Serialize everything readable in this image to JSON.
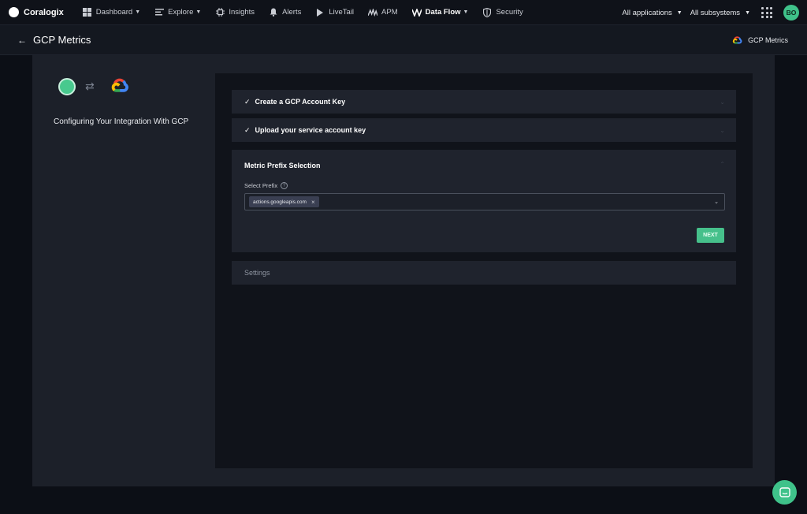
{
  "app": {
    "brand": "Coralogix",
    "avatar_initials": "BO",
    "accent_color": "#46c08b"
  },
  "nav": {
    "items": [
      {
        "label": "Dashboard",
        "icon": "dashboard-icon",
        "has_caret": true
      },
      {
        "label": "Explore",
        "icon": "explore-icon",
        "has_caret": true
      },
      {
        "label": "Insights",
        "icon": "insights-icon",
        "has_caret": false
      },
      {
        "label": "Alerts",
        "icon": "bell-icon",
        "has_caret": false
      },
      {
        "label": "LiveTail",
        "icon": "play-icon",
        "has_caret": false
      },
      {
        "label": "APM",
        "icon": "apm-icon",
        "has_caret": false
      },
      {
        "label": "Data Flow",
        "icon": "data-flow-icon",
        "has_caret": true
      },
      {
        "label": "Security",
        "icon": "shield-icon",
        "has_caret": false
      }
    ],
    "applications": "All applications",
    "subsystems": "All subsystems"
  },
  "header": {
    "title": "GCP Metrics",
    "right_label": "GCP Metrics"
  },
  "left": {
    "config_label": "Configuring Your Integration With GCP"
  },
  "steps": {
    "step1": "Create a GCP Account Key",
    "step2": "Upload your service account key",
    "step3": "Metric Prefix Selection",
    "step4": "Settings"
  },
  "prefix": {
    "label": "Select Prefix",
    "selected_chip": "actions.googleapis.com",
    "next_label": "NEXT"
  }
}
